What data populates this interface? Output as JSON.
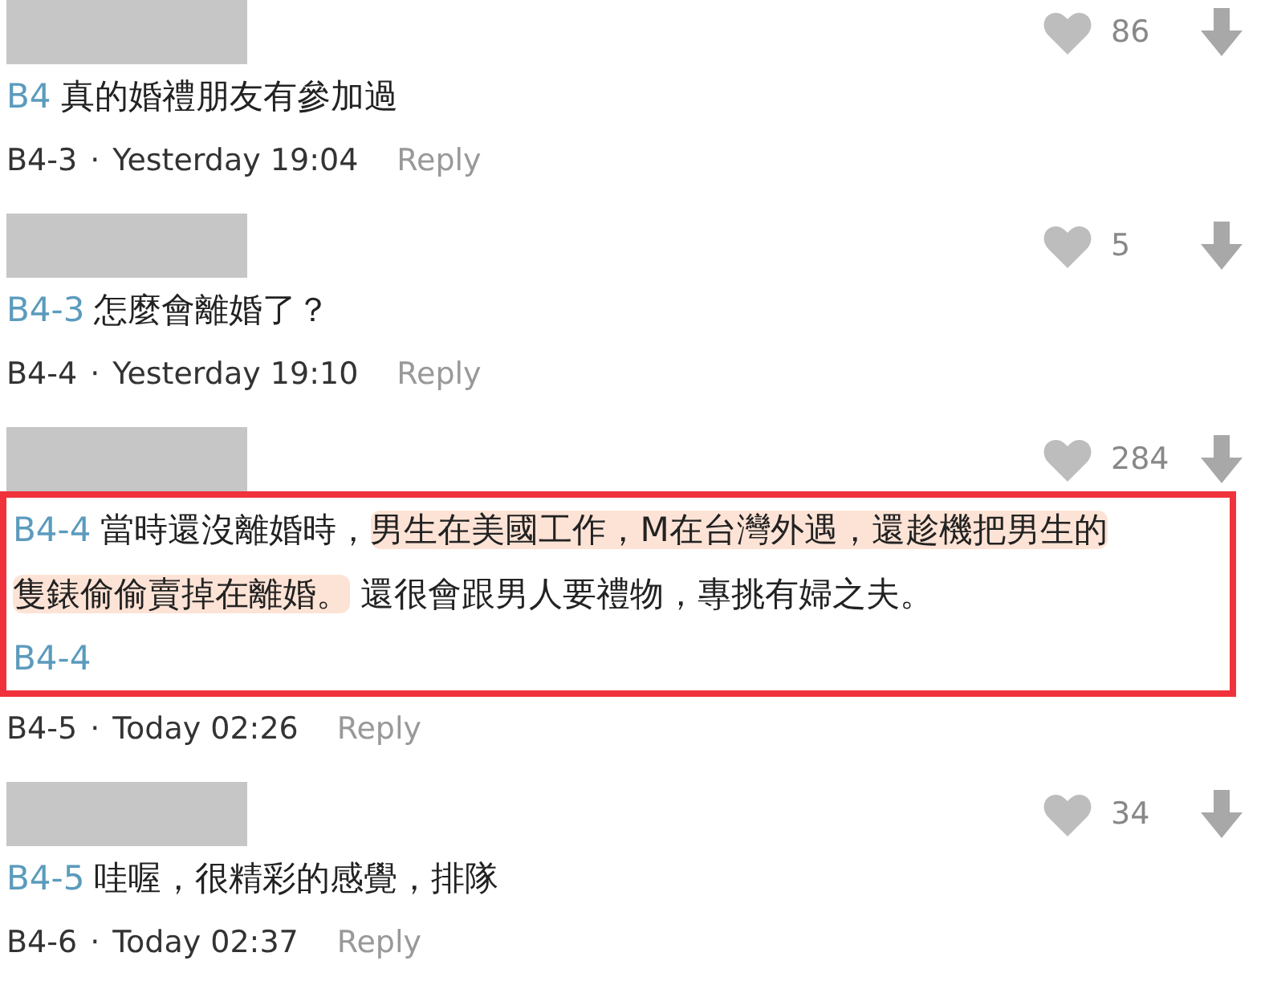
{
  "comments": [
    {
      "votes": "86",
      "lines": [
        [
          {
            "kind": "tag",
            "text": "B4"
          },
          {
            "kind": "text",
            "text": "真的婚禮朋友有參加過"
          }
        ]
      ],
      "floor": "B4-3",
      "sep": "·",
      "time": "Yesterday 19:04",
      "reply": "Reply",
      "boxed": false
    },
    {
      "votes": "5",
      "lines": [
        [
          {
            "kind": "tag",
            "text": "B4-3"
          },
          {
            "kind": "text",
            "text": "怎麼會離婚了？"
          }
        ]
      ],
      "floor": "B4-4",
      "sep": "·",
      "time": "Yesterday 19:10",
      "reply": "Reply",
      "boxed": false
    },
    {
      "votes": "284",
      "lines": [
        [
          {
            "kind": "tag",
            "text": "B4-4"
          },
          {
            "kind": "text",
            "text": "當時還沒離婚時，"
          },
          {
            "kind": "highlight",
            "text": "男生在美國工作，M在台灣外遇，還趁機把男生的"
          }
        ],
        [
          {
            "kind": "highlight",
            "text": "隻錶偷偷賣掉在離婚。"
          },
          {
            "kind": "text",
            "text": " 還很會跟男人要禮物，專挑有婦之夫。"
          }
        ],
        [
          {
            "kind": "tag",
            "text": "B4-4"
          }
        ]
      ],
      "floor": "B4-5",
      "sep": "·",
      "time": "Today 02:26",
      "reply": "Reply",
      "boxed": true
    },
    {
      "votes": "34",
      "lines": [
        [
          {
            "kind": "tag",
            "text": "B4-5"
          },
          {
            "kind": "text",
            "text": "哇喔，很精彩的感覺，排隊"
          }
        ]
      ],
      "floor": "B4-6",
      "sep": "·",
      "time": "Today 02:37",
      "reply": "Reply",
      "boxed": false
    }
  ]
}
